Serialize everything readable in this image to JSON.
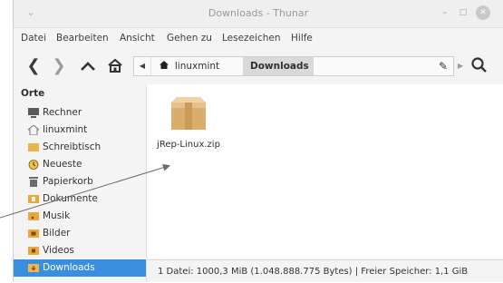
{
  "window": {
    "title": "Downloads - Thunar",
    "min": "–",
    "max": "□",
    "close": "✕",
    "collapse": "⌄"
  },
  "menu": [
    "Datei",
    "Bearbeiten",
    "Ansicht",
    "Gehen zu",
    "Lesezeichen",
    "Hilfe"
  ],
  "toolbar": {
    "back": "❮",
    "forward": "❯",
    "up": "⌃",
    "home": "⌂"
  },
  "path": {
    "left_arrow": "◀",
    "home_crumb": "linuxmint",
    "active_crumb": "Downloads",
    "edit": "✎",
    "right_arrow": "▶"
  },
  "sidebar": {
    "heading": "Orte",
    "items": [
      {
        "label": "Rechner",
        "icon": "computer-icon",
        "color": "#5a5a5a"
      },
      {
        "label": "linuxmint",
        "icon": "home-folder-icon",
        "color": "#8a8a8a"
      },
      {
        "label": "Schreibtisch",
        "icon": "desktop-folder-icon",
        "color": "#e8b54a"
      },
      {
        "label": "Neueste",
        "icon": "clock-icon",
        "color": "#e1a32a"
      },
      {
        "label": "Papierkorb",
        "icon": "trash-icon",
        "color": "#6a6a6a"
      },
      {
        "label": "Dokumente",
        "icon": "documents-folder-icon",
        "color": "#e8a93a"
      },
      {
        "label": "Musik",
        "icon": "music-folder-icon",
        "color": "#e8a93a"
      },
      {
        "label": "Bilder",
        "icon": "pictures-folder-icon",
        "color": "#e8a93a"
      },
      {
        "label": "Videos",
        "icon": "videos-folder-icon",
        "color": "#e8a93a"
      },
      {
        "label": "Downloads",
        "icon": "downloads-folder-icon",
        "color": "#e8a93a",
        "selected": true
      }
    ]
  },
  "files": [
    {
      "name": "jRep-Linux.zip",
      "icon": "archive-box-icon"
    }
  ],
  "status": "1 Datei: 1000,3 MiB (1.048.888.775 Bytes) | Freier Speicher: 1,1 GiB"
}
